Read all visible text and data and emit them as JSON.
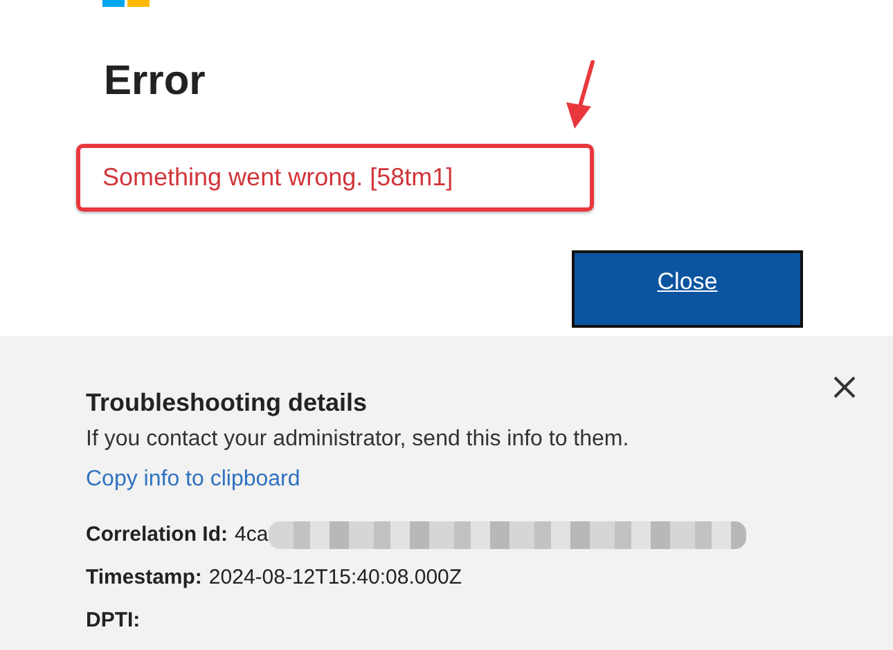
{
  "error": {
    "title": "Error",
    "message": "Something went wrong. [58tm1]",
    "highlighted": true
  },
  "close_button": "Close",
  "details": {
    "title": "Troubleshooting details",
    "description": "If you contact your administrator, send this info to them.",
    "copy_link": "Copy info to clipboard",
    "fields": [
      {
        "label": "Correlation Id:",
        "value": "4ca",
        "redacted": true
      },
      {
        "label": "Timestamp:",
        "value": "2024-08-12T15:40:08.000Z",
        "redacted": false
      },
      {
        "label": "DPTI:",
        "redacted": false
      }
    ]
  }
}
